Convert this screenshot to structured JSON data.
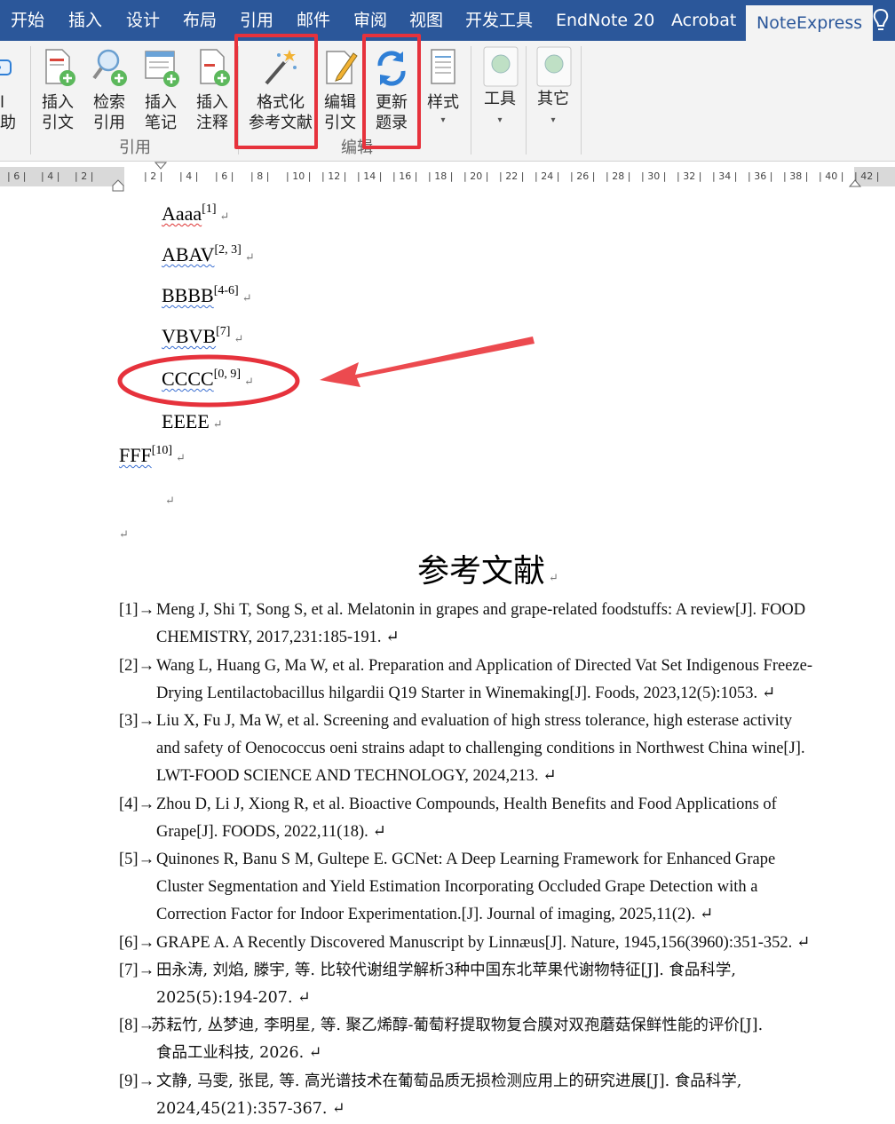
{
  "tabs": {
    "start": "开始",
    "insert": "插入",
    "design": "设计",
    "layout": "布局",
    "references": "引用",
    "mailings": "邮件",
    "review": "审阅",
    "view": "视图",
    "developer": "开发工具",
    "endnote": "EndNote 20",
    "acrobat": "Acrobat",
    "noteexpress": "NoteExpress"
  },
  "ribbon": {
    "partial_left": {
      "line1": "l",
      "line2": "助"
    },
    "insert_citation": {
      "line1": "插入",
      "line2": "引文"
    },
    "search_citation": {
      "line1": "检索",
      "line2": "引用"
    },
    "insert_note": {
      "line1": "插入",
      "line2": "笔记"
    },
    "insert_annotation": {
      "line1": "插入",
      "line2": "注释"
    },
    "format_bibliography": {
      "line1": "格式化",
      "line2": "参考文献"
    },
    "edit_citation": {
      "line1": "编辑",
      "line2": "引文"
    },
    "update_bibliography": {
      "line1": "更新",
      "line2": "题录"
    },
    "style": {
      "line1": "样式"
    },
    "tools": {
      "line1": "工具"
    },
    "other": {
      "line1": "其它"
    },
    "group_cite": "引用",
    "group_edit": "编辑",
    "dropdown_glyph": "▾"
  },
  "ruler": {
    "left_labels": [
      "6",
      "4",
      "2"
    ],
    "labels": [
      "2",
      "4",
      "6",
      "8",
      "10",
      "12",
      "14",
      "16",
      "18",
      "20",
      "22",
      "24",
      "26",
      "28",
      "30",
      "32",
      "34",
      "36",
      "38",
      "40",
      "42"
    ]
  },
  "doc": {
    "lines": [
      {
        "text": "Aaaa",
        "sup": "[1]"
      },
      {
        "text": "ABAV",
        "sup": "[2, 3]"
      },
      {
        "text": "BBBB",
        "sup": "[4-6]"
      },
      {
        "text": "VBVB",
        "sup": "[7]"
      },
      {
        "text": "CCCC",
        "sup": "[0, 9]"
      },
      {
        "text": "EEEE",
        "sup": ""
      },
      {
        "text": "FFF",
        "sup": "[10]"
      }
    ],
    "para_mark": "↵",
    "heading": "参考文献",
    "references": [
      {
        "num": "[1]→",
        "lines": [
          "Meng J, Shi T, Song S, et al. Melatonin in grapes and grape-related foodstuffs: A review[J]. FOOD",
          "CHEMISTRY, 2017,231:185-191. ↵"
        ]
      },
      {
        "num": "[2]→",
        "lines": [
          "Wang L, Huang G, Ma W, et al. Preparation and Application of Directed Vat Set Indigenous Freeze-",
          "Drying Lentilactobacillus hilgardii Q19 Starter in Winemaking[J]. Foods, 2023,12(5):1053. ↵"
        ]
      },
      {
        "num": "[3]→",
        "lines": [
          "Liu X, Fu J, Ma W, et al. Screening and evaluation of high stress tolerance, high esterase activity",
          "and safety of Oenococcus oeni strains adapt to challenging conditions in Northwest China wine[J].",
          "LWT-FOOD SCIENCE AND TECHNOLOGY, 2024,213. ↵"
        ]
      },
      {
        "num": "[4]→",
        "lines": [
          "Zhou D, Li J, Xiong R, et al. Bioactive Compounds, Health Benefits and Food Applications of",
          "Grape[J]. FOODS, 2022,11(18). ↵"
        ]
      },
      {
        "num": "[5]→",
        "lines": [
          "Quinones R, Banu S M, Gultepe E. GCNet: A Deep Learning Framework for Enhanced Grape",
          "Cluster Segmentation and Yield Estimation Incorporating Occluded Grape Detection with a",
          "Correction Factor for Indoor Experimentation.[J]. Journal of imaging, 2025,11(2). ↵"
        ]
      },
      {
        "num": "[6]→",
        "lines": [
          "GRAPE A. A Recently Discovered Manuscript by Linnæus[J]. Nature, 1945,156(3960):351-352. ↵"
        ]
      },
      {
        "num": "[7]→",
        "lines": [
          "田永涛, 刘焰, 滕宇, 等. 比较代谢组学解析3种中国东北苹果代谢物特征[J]. 食品科学,",
          "2025(5):194-207. ↵"
        ]
      },
      {
        "num": "[8]→",
        "lines": [
          "苏耘竹, 丛梦迪, 李明星, 等. 聚乙烯醇-葡萄籽提取物复合膜对双孢蘑菇保鲜性能的评价[J].",
          "食品工业科技, 2026. ↵"
        ]
      },
      {
        "num": "[9]→",
        "lines": [
          "文静, 马雯, 张昆, 等. 高光谱技术在葡萄品质无损检测应用上的研究进展[J]. 食品科学,",
          "2024,45(21):357-367. ↵"
        ]
      }
    ]
  },
  "colors": {
    "tabbar": "#2b579a",
    "highlight": "#e6323c",
    "squiggle": "#3b6fd1"
  }
}
